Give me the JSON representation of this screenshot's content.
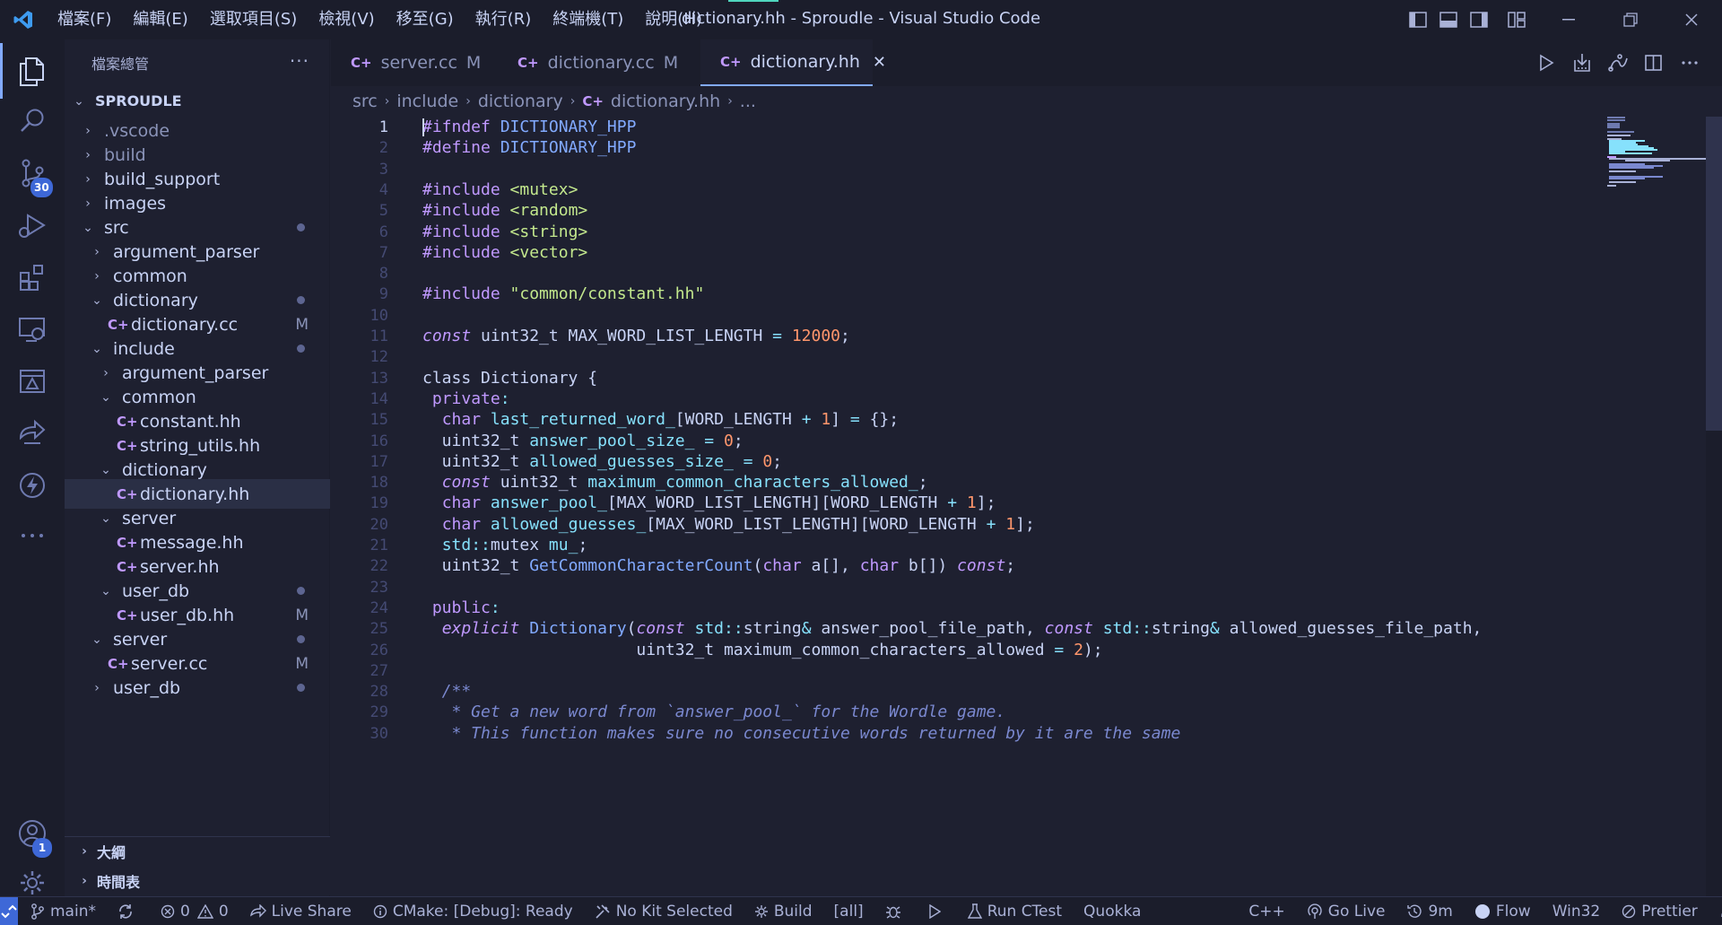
{
  "window": {
    "title": "dictionary.hh - Sproudle - Visual Studio Code"
  },
  "menu": [
    "檔案(F)",
    "編輯(E)",
    "選取項目(S)",
    "檢視(V)",
    "移至(G)",
    "執行(R)",
    "終端機(T)",
    "說明(H)"
  ],
  "activity": {
    "source_control_badge": "30",
    "accounts_badge": "1"
  },
  "sidebar": {
    "title": "檔案總管",
    "more": "···",
    "root": "SPROUDLE",
    "tree": [
      {
        "label": ".vscode",
        "kind": "folder",
        "open": false,
        "depth": 1,
        "dim": true
      },
      {
        "label": "build",
        "kind": "folder",
        "open": false,
        "depth": 1,
        "dim": true
      },
      {
        "label": "build_support",
        "kind": "folder",
        "open": false,
        "depth": 1
      },
      {
        "label": "images",
        "kind": "folder",
        "open": false,
        "depth": 1
      },
      {
        "label": "src",
        "kind": "folder",
        "open": true,
        "depth": 1,
        "dot": true
      },
      {
        "label": "argument_parser",
        "kind": "folder",
        "open": false,
        "depth": 2
      },
      {
        "label": "common",
        "kind": "folder",
        "open": false,
        "depth": 2
      },
      {
        "label": "dictionary",
        "kind": "folder",
        "open": true,
        "depth": 2,
        "dot": true
      },
      {
        "label": "dictionary.cc",
        "kind": "file",
        "depth": 3,
        "status": "M"
      },
      {
        "label": "include",
        "kind": "folder",
        "open": true,
        "depth": 2,
        "dot": true
      },
      {
        "label": "argument_parser",
        "kind": "folder",
        "open": false,
        "depth": 3
      },
      {
        "label": "common",
        "kind": "folder",
        "open": true,
        "depth": 3
      },
      {
        "label": "constant.hh",
        "kind": "file",
        "depth": 4
      },
      {
        "label": "string_utils.hh",
        "kind": "file",
        "depth": 4
      },
      {
        "label": "dictionary",
        "kind": "folder",
        "open": true,
        "depth": 3
      },
      {
        "label": "dictionary.hh",
        "kind": "file",
        "depth": 4,
        "selected": true
      },
      {
        "label": "server",
        "kind": "folder",
        "open": true,
        "depth": 3
      },
      {
        "label": "message.hh",
        "kind": "file",
        "depth": 4
      },
      {
        "label": "server.hh",
        "kind": "file",
        "depth": 4
      },
      {
        "label": "user_db",
        "kind": "folder",
        "open": true,
        "depth": 3,
        "dot": true
      },
      {
        "label": "user_db.hh",
        "kind": "file",
        "depth": 4,
        "status": "M"
      },
      {
        "label": "server",
        "kind": "folder",
        "open": true,
        "depth": 2,
        "dot": true
      },
      {
        "label": "server.cc",
        "kind": "file",
        "depth": 3,
        "status": "M"
      },
      {
        "label": "user_db",
        "kind": "folder",
        "open": false,
        "depth": 2,
        "dot": true
      }
    ],
    "outline": "大綱",
    "timeline": "時間表"
  },
  "tabs": [
    {
      "label": "server.cc",
      "mod": "M",
      "active": false
    },
    {
      "label": "dictionary.cc",
      "mod": "M",
      "active": false
    },
    {
      "label": "dictionary.hh",
      "mod": "",
      "active": true
    }
  ],
  "breadcrumb": [
    "src",
    "include",
    "dictionary",
    "dictionary.hh",
    "..."
  ],
  "editor": {
    "current_line": 1,
    "lines": [
      [
        [
          "t-pre",
          "#ifndef "
        ],
        [
          "t-macro",
          "DICTIONARY_HPP"
        ]
      ],
      [
        [
          "t-pre",
          "#define "
        ],
        [
          "t-macro",
          "DICTIONARY_HPP"
        ]
      ],
      [],
      [
        [
          "t-pre",
          "#include "
        ],
        [
          "t-str",
          "<mutex>"
        ]
      ],
      [
        [
          "t-pre",
          "#include "
        ],
        [
          "t-str",
          "<random>"
        ]
      ],
      [
        [
          "t-pre",
          "#include "
        ],
        [
          "t-str",
          "<string>"
        ]
      ],
      [
        [
          "t-pre",
          "#include "
        ],
        [
          "t-str",
          "<vector>"
        ]
      ],
      [],
      [
        [
          "t-pre",
          "#include "
        ],
        [
          "t-str",
          "\"common/constant.hh\""
        ]
      ],
      [],
      [
        [
          "t-kwi",
          "const"
        ],
        [
          "t-plain",
          " uint32_t MAX_WORD_LIST_LENGTH "
        ],
        [
          "t-op",
          "="
        ],
        [
          "t-plain",
          " "
        ],
        [
          "t-num",
          "12000"
        ],
        [
          "t-plain",
          ";"
        ]
      ],
      [],
      [
        [
          "t-plain",
          "class Dictionary {"
        ]
      ],
      [
        [
          "t-plain",
          " "
        ],
        [
          "t-kw",
          "private"
        ],
        [
          "t-op",
          ":"
        ]
      ],
      [
        [
          "t-plain",
          "  "
        ],
        [
          "t-kw",
          "char"
        ],
        [
          "t-plain",
          " "
        ],
        [
          "t-var",
          "last_returned_word_"
        ],
        [
          "t-plain",
          "[WORD_LENGTH "
        ],
        [
          "t-op",
          "+"
        ],
        [
          "t-plain",
          " "
        ],
        [
          "t-num",
          "1"
        ],
        [
          "t-plain",
          "] "
        ],
        [
          "t-op",
          "="
        ],
        [
          "t-plain",
          " {};"
        ]
      ],
      [
        [
          "t-plain",
          "  uint32_t "
        ],
        [
          "t-var",
          "answer_pool_size_"
        ],
        [
          "t-plain",
          " "
        ],
        [
          "t-op",
          "="
        ],
        [
          "t-plain",
          " "
        ],
        [
          "t-num",
          "0"
        ],
        [
          "t-plain",
          ";"
        ]
      ],
      [
        [
          "t-plain",
          "  uint32_t "
        ],
        [
          "t-var",
          "allowed_guesses_size_"
        ],
        [
          "t-plain",
          " "
        ],
        [
          "t-op",
          "="
        ],
        [
          "t-plain",
          " "
        ],
        [
          "t-num",
          "0"
        ],
        [
          "t-plain",
          ";"
        ]
      ],
      [
        [
          "t-plain",
          "  "
        ],
        [
          "t-kwi",
          "const"
        ],
        [
          "t-plain",
          " uint32_t "
        ],
        [
          "t-var",
          "maximum_common_characters_allowed_"
        ],
        [
          "t-plain",
          ";"
        ]
      ],
      [
        [
          "t-plain",
          "  "
        ],
        [
          "t-kw",
          "char"
        ],
        [
          "t-plain",
          " "
        ],
        [
          "t-var",
          "answer_pool_"
        ],
        [
          "t-plain",
          "[MAX_WORD_LIST_LENGTH][WORD_LENGTH "
        ],
        [
          "t-op",
          "+"
        ],
        [
          "t-plain",
          " "
        ],
        [
          "t-num",
          "1"
        ],
        [
          "t-plain",
          "];"
        ]
      ],
      [
        [
          "t-plain",
          "  "
        ],
        [
          "t-kw",
          "char"
        ],
        [
          "t-plain",
          " "
        ],
        [
          "t-var",
          "allowed_guesses_"
        ],
        [
          "t-plain",
          "[MAX_WORD_LIST_LENGTH][WORD_LENGTH "
        ],
        [
          "t-op",
          "+"
        ],
        [
          "t-plain",
          " "
        ],
        [
          "t-num",
          "1"
        ],
        [
          "t-plain",
          "];"
        ]
      ],
      [
        [
          "t-plain",
          "  "
        ],
        [
          "t-var",
          "std"
        ],
        [
          "t-op",
          "::"
        ],
        [
          "t-plain",
          "mutex "
        ],
        [
          "t-var",
          "mu_"
        ],
        [
          "t-plain",
          ";"
        ]
      ],
      [
        [
          "t-plain",
          "  uint32_t "
        ],
        [
          "t-fn",
          "GetCommonCharacterCount"
        ],
        [
          "t-plain",
          "("
        ],
        [
          "t-kw",
          "char"
        ],
        [
          "t-plain",
          " a[], "
        ],
        [
          "t-kw",
          "char"
        ],
        [
          "t-plain",
          " b[]) "
        ],
        [
          "t-kwi",
          "const"
        ],
        [
          "t-plain",
          ";"
        ]
      ],
      [],
      [
        [
          "t-plain",
          " "
        ],
        [
          "t-kw",
          "public"
        ],
        [
          "t-op",
          ":"
        ]
      ],
      [
        [
          "t-plain",
          "  "
        ],
        [
          "t-kwi",
          "explicit"
        ],
        [
          "t-plain",
          " "
        ],
        [
          "t-fn",
          "Dictionary"
        ],
        [
          "t-plain",
          "("
        ],
        [
          "t-kwi",
          "const"
        ],
        [
          "t-plain",
          " "
        ],
        [
          "t-var",
          "std"
        ],
        [
          "t-op",
          "::"
        ],
        [
          "t-plain",
          "string"
        ],
        [
          "t-op",
          "&"
        ],
        [
          "t-plain",
          " answer_pool_file_path, "
        ],
        [
          "t-kwi",
          "const"
        ],
        [
          "t-plain",
          " "
        ],
        [
          "t-var",
          "std"
        ],
        [
          "t-op",
          "::"
        ],
        [
          "t-plain",
          "string"
        ],
        [
          "t-op",
          "&"
        ],
        [
          "t-plain",
          " allowed_guesses_file_path,"
        ]
      ],
      [
        [
          "t-plain",
          "                      uint32_t maximum_common_characters_allowed "
        ],
        [
          "t-op",
          "="
        ],
        [
          "t-plain",
          " "
        ],
        [
          "t-num",
          "2"
        ],
        [
          "t-plain",
          ");"
        ]
      ],
      [],
      [
        [
          "t-cmt",
          "  /**"
        ]
      ],
      [
        [
          "t-cmt",
          "   * Get a new word from `answer_pool_` for the Wordle game."
        ]
      ],
      [
        [
          "t-cmt",
          "   * This function makes sure no consecutive words returned by it are the same"
        ]
      ]
    ]
  },
  "statusbar": {
    "branch": "main*",
    "errors": "0",
    "warnings": "0",
    "live_share": "Live Share",
    "cmake": "CMake: [Debug]: Ready",
    "kit": "No Kit Selected",
    "build": "Build",
    "target": "[all]",
    "run_ctest": "Run CTest",
    "quokka": "Quokka",
    "language": "C++",
    "go_live": "Go Live",
    "time": "9m",
    "flow": "Flow",
    "platform": "Win32",
    "prettier": "Prettier"
  }
}
